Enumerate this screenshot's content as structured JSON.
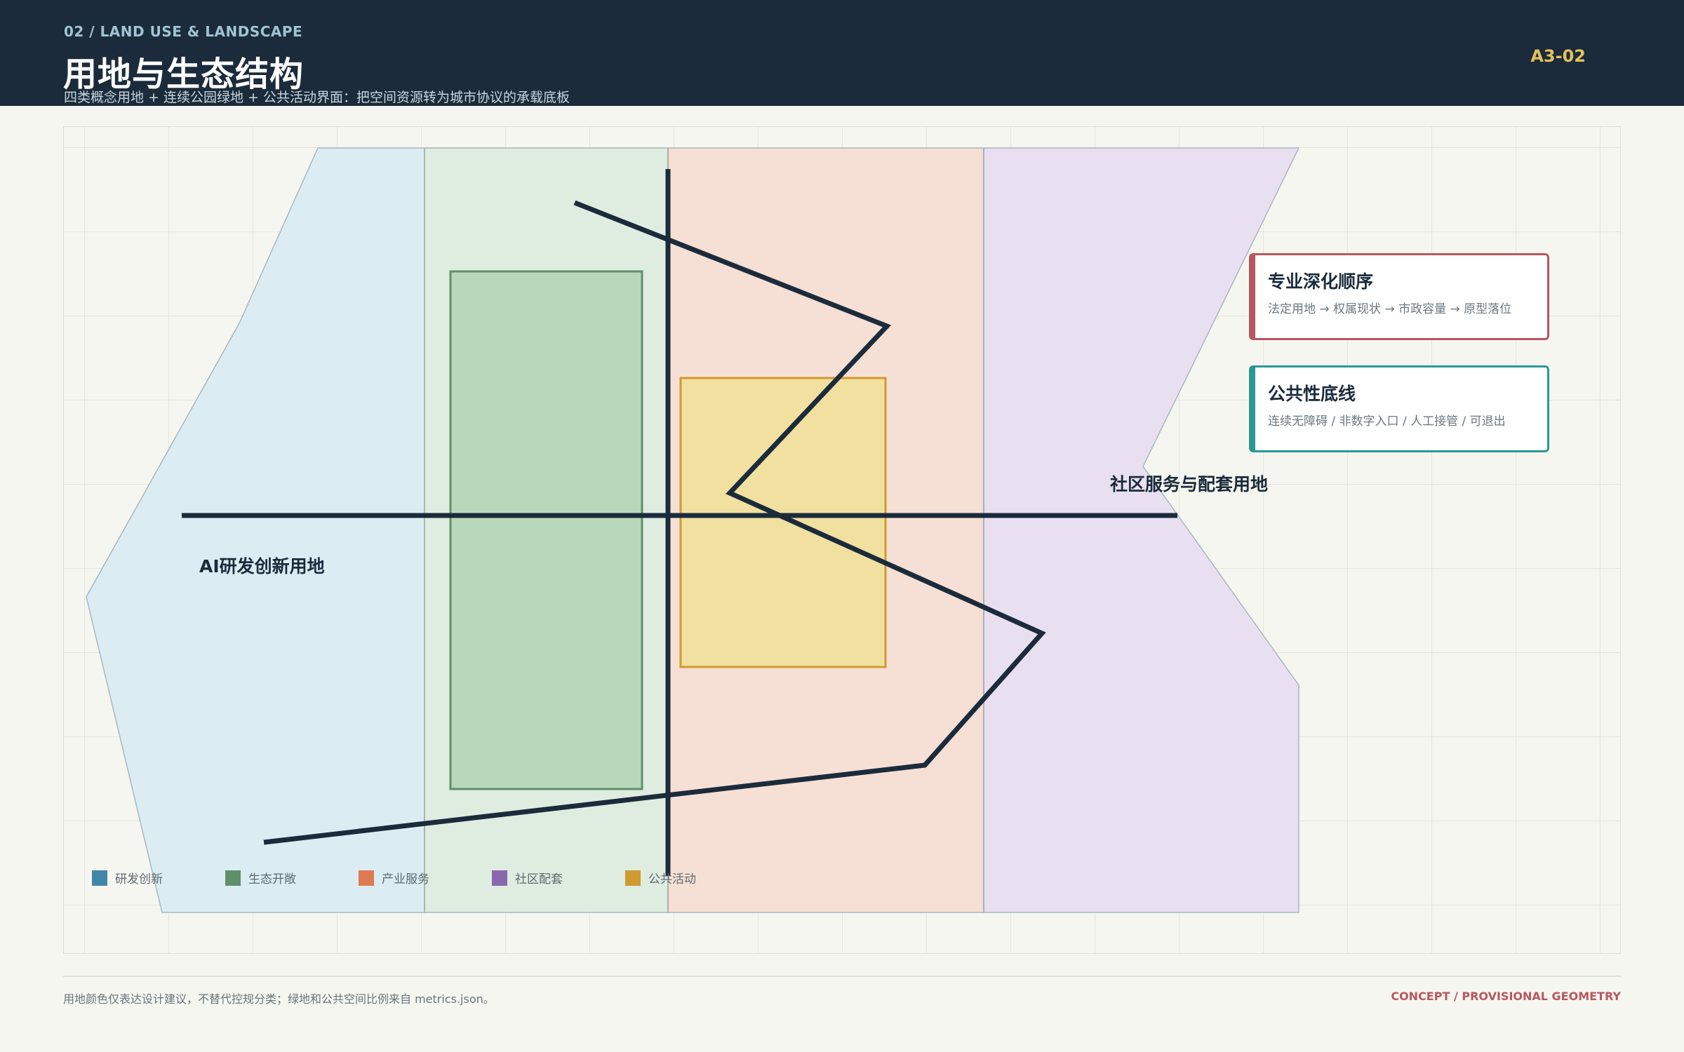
{
  "header": {
    "eyebrow": "02 / LAND USE & LANDSCAPE",
    "title": "用地与生态结构",
    "subtitle": "四类概念用地 + 连续公园绿地 + 公共活动界面：把空间资源转为城市协议的承载底板",
    "sheet_id": "A3-02"
  },
  "plan": {
    "labels": {
      "west": "AI研发创新用地",
      "east": "社区服务与配套用地"
    },
    "legend": [
      {
        "label": "研发创新",
        "color": "#3f86a8"
      },
      {
        "label": "生态开敞",
        "color": "#5e9068"
      },
      {
        "label": "产业服务",
        "color": "#dd7a52"
      },
      {
        "label": "社区配套",
        "color": "#8a68ad"
      },
      {
        "label": "公共活动",
        "color": "#cf9b2f"
      }
    ],
    "zone_colors": {
      "research": "#dbedf3",
      "ecology": "#dfece0",
      "industry": "#f6dfd4",
      "community": "#e8e0f1",
      "park": "#b9d8bb",
      "public": "#f2e0a0",
      "line": "#1b2b3b"
    }
  },
  "cards": [
    {
      "title": "专业深化顺序",
      "text": "法定用地 → 权属现状 → 市政容量 → 原型落位"
    },
    {
      "title": "公共性底线",
      "text": "连续无障碍 / 非数字入口 / 人工接管 / 可退出"
    }
  ],
  "footer": {
    "note": "用地颜色仅表达设计建议，不替代控规分类；绿地和公共空间比例来自 metrics.json。",
    "status": "CONCEPT / PROVISIONAL GEOMETRY"
  }
}
